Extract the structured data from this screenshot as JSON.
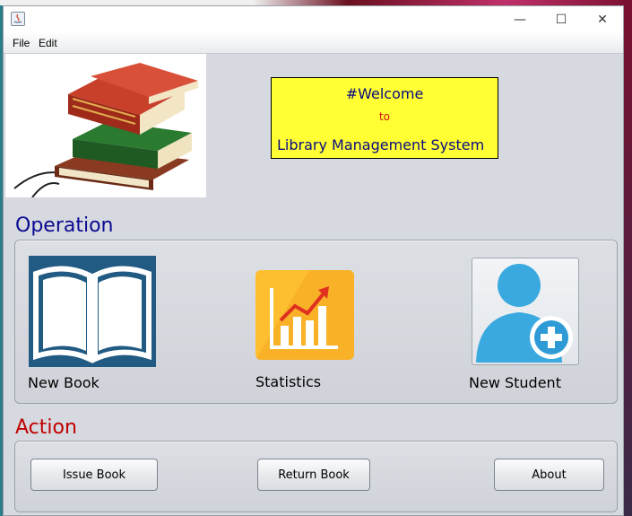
{
  "window": {
    "controls": {
      "minimize": "—",
      "maximize": "☐",
      "close": "✕"
    }
  },
  "menubar": {
    "items": [
      "File",
      "Edit"
    ]
  },
  "welcome": {
    "line1": "#Welcome",
    "line2": "to",
    "line3": "Library Management System"
  },
  "operation": {
    "heading": "Operation",
    "heading_color": "#0a0a90",
    "items": [
      {
        "label": "New Book",
        "icon": "open-book-icon"
      },
      {
        "label": "Statistics",
        "icon": "chart-icon"
      },
      {
        "label": "New Student",
        "icon": "add-user-icon"
      }
    ]
  },
  "action": {
    "heading": "Action",
    "heading_color": "#c00000",
    "buttons": [
      "Issue Book",
      "Return Book",
      "About"
    ]
  },
  "colors": {
    "welcome_bg": "#ffff33",
    "book_icon_bg": "#215a82",
    "stats_icon_bg": "#fdbf30",
    "user_icon_blue": "#3aa9df"
  }
}
